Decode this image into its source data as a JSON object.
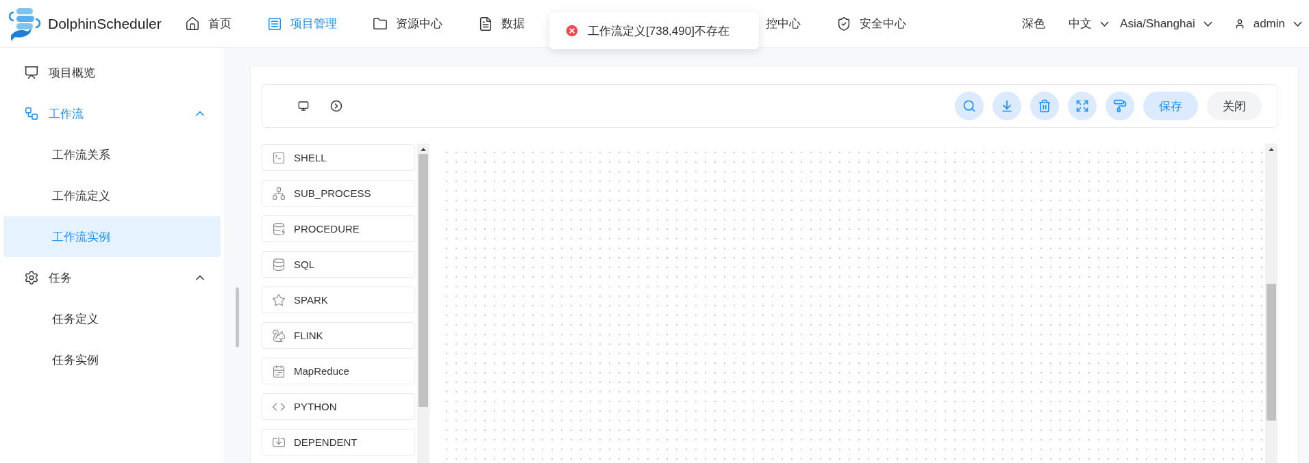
{
  "brand": {
    "name": "DolphinScheduler"
  },
  "nav": [
    {
      "label": "首页",
      "selected": false
    },
    {
      "label": "项目管理",
      "selected": true
    },
    {
      "label": "资源中心",
      "selected": false
    },
    {
      "label": "数据",
      "selected": false
    },
    {
      "label": "控中心",
      "selected": false
    },
    {
      "label": "安全中心",
      "selected": false
    }
  ],
  "toast": {
    "kind": "error",
    "message": "工作流定义[738,490]不存在"
  },
  "header_right": {
    "theme": "深色",
    "language": "中文",
    "timezone": "Asia/Shanghai",
    "user": "admin"
  },
  "sidebar": {
    "items": [
      {
        "label": "项目概览",
        "selected": false
      },
      {
        "label": "工作流",
        "selected": false,
        "expanded": true,
        "children": [
          {
            "label": "工作流关系",
            "selected": false
          },
          {
            "label": "工作流定义",
            "selected": false
          },
          {
            "label": "工作流实例",
            "selected": true
          }
        ]
      },
      {
        "label": "任务",
        "selected": false,
        "expanded": true,
        "children": [
          {
            "label": "任务定义",
            "selected": false
          },
          {
            "label": "任务实例",
            "selected": false
          }
        ]
      }
    ]
  },
  "toolbar": {
    "buttons": [
      {
        "label": "保存",
        "kind": "primary"
      },
      {
        "label": "关闭",
        "kind": "default"
      }
    ]
  },
  "tasks": [
    {
      "label": "SHELL"
    },
    {
      "label": "SUB_PROCESS"
    },
    {
      "label": "PROCEDURE"
    },
    {
      "label": "SQL"
    },
    {
      "label": "SPARK"
    },
    {
      "label": "FLINK"
    },
    {
      "label": "MapReduce"
    },
    {
      "label": "PYTHON"
    },
    {
      "label": "DEPENDENT"
    }
  ]
}
